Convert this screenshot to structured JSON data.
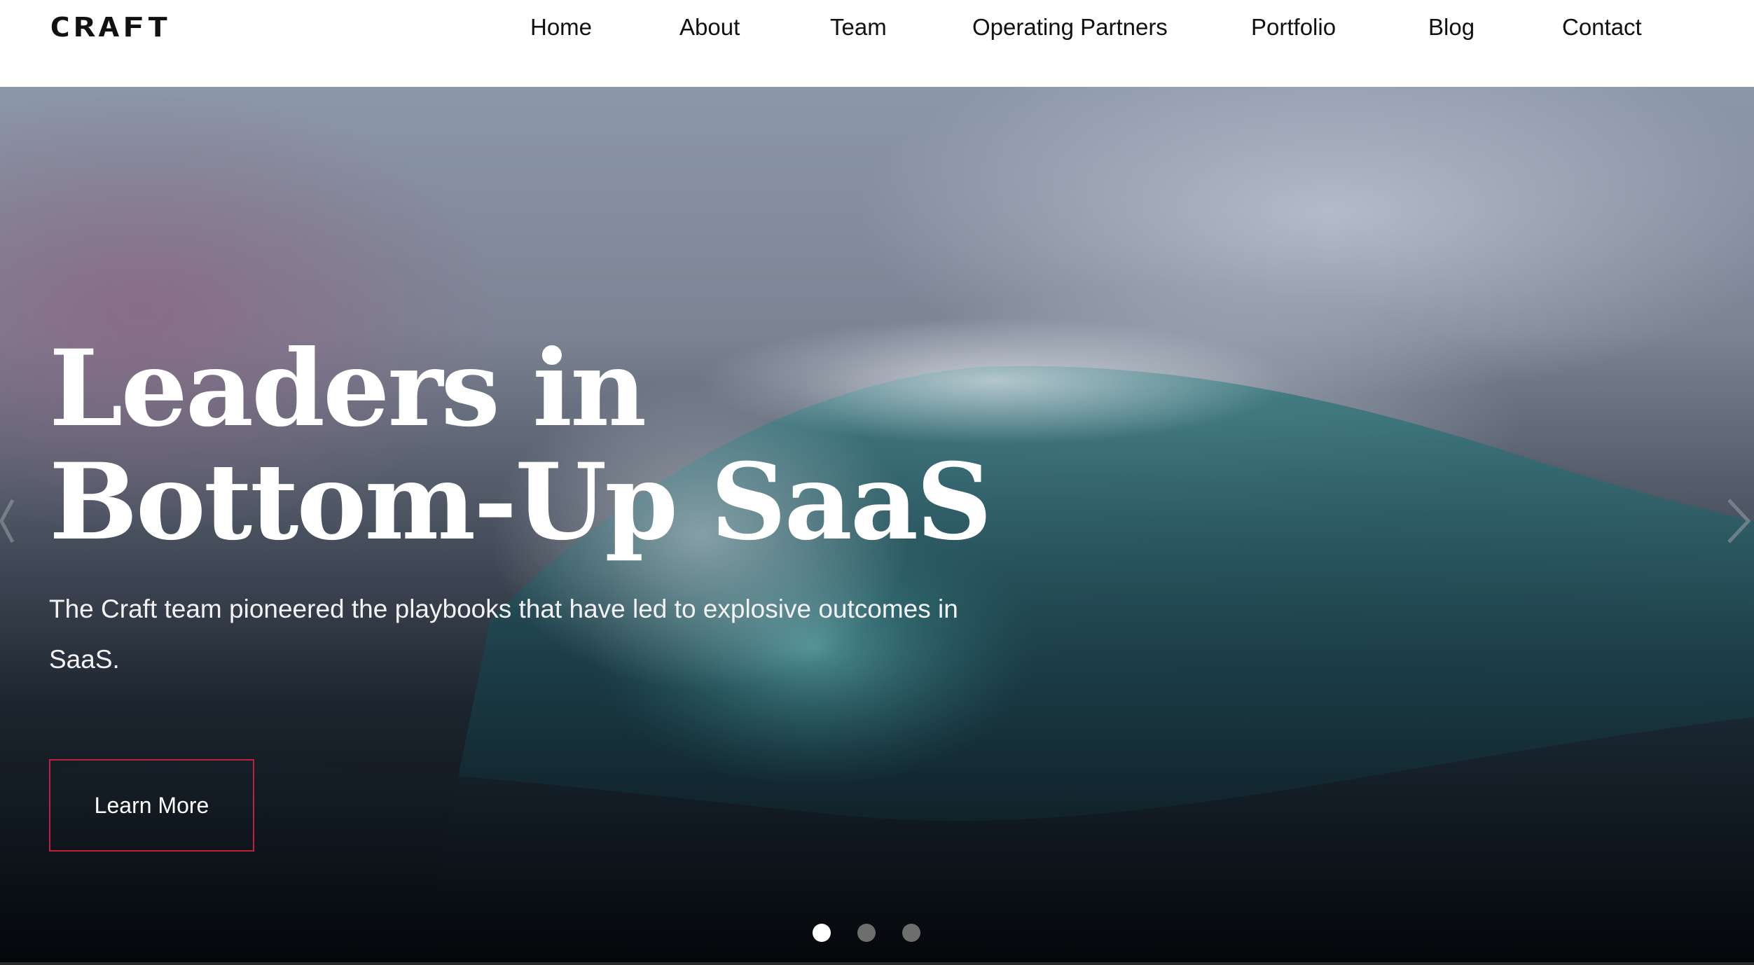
{
  "header": {
    "logo": "CRAFT",
    "nav": {
      "home": "Home",
      "about": "About",
      "team": "Team",
      "operating_partners": "Operating Partners",
      "portfolio": "Portfolio",
      "blog": "Blog",
      "contact": "Contact"
    }
  },
  "hero": {
    "headline_line1": "Leaders in",
    "headline_line2": "Bottom-Up SaaS",
    "subtext": "The Craft team pioneered the playbooks that have led to explosive outcomes in SaaS.",
    "cta_label": "Learn More",
    "prev_icon": "chevron-left-icon",
    "next_icon": "chevron-right-icon",
    "slides_total": 3,
    "active_slide": 1
  },
  "colors": {
    "accent": "#c0203a",
    "nav_text": "#111111",
    "hero_text": "#ffffff",
    "dot_active": "#ffffff",
    "dot_inactive": "#6e6e6e"
  }
}
